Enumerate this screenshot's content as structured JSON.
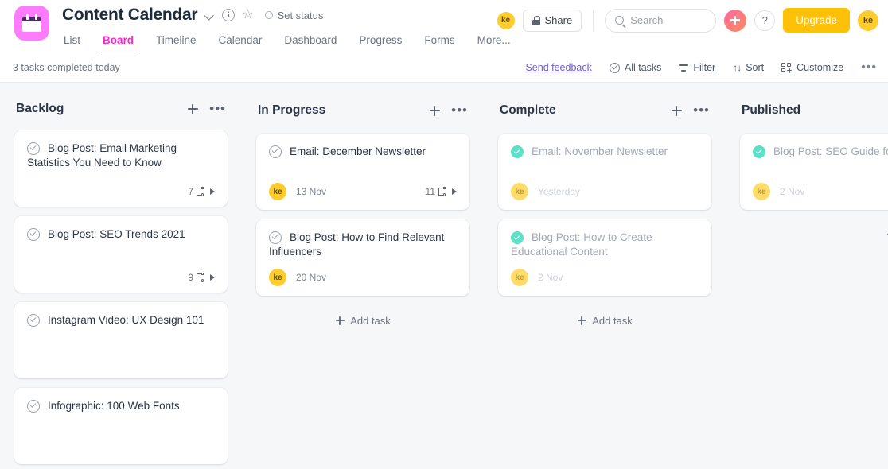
{
  "header": {
    "app_icon": "calendar-icon",
    "title": "Content Calendar",
    "title_chevron": "chevron-down-icon",
    "info_icon": "i",
    "star_icon": "☆",
    "set_status_label": "Set status",
    "tabs": [
      {
        "label": "List",
        "active": false
      },
      {
        "label": "Board",
        "active": true
      },
      {
        "label": "Timeline",
        "active": false
      },
      {
        "label": "Calendar",
        "active": false
      },
      {
        "label": "Dashboard",
        "active": false
      },
      {
        "label": "Progress",
        "active": false
      },
      {
        "label": "Forms",
        "active": false
      },
      {
        "label": "More...",
        "active": false
      }
    ],
    "avatar_initials": "ke",
    "share_label": "Share",
    "share_icon": "lock-icon",
    "search_placeholder": "Search",
    "search_value": "",
    "plus_icon": "plus-icon",
    "help_icon": "?",
    "upgrade_label": "Upgrade",
    "profile_initials": "ke",
    "accent_color": "#ff25ce",
    "avatar_color": "#ffcc2d",
    "upgrade_color": "#ffc107"
  },
  "toolbar": {
    "tasks_today": "3 tasks completed today",
    "feedback_label": "Send feedback",
    "all_tasks_label": "All tasks",
    "filter_label": "Filter",
    "sort_label": "Sort",
    "customize_label": "Customize",
    "overflow_label": "•••"
  },
  "board": {
    "add_task_label": "Add task",
    "columns": [
      {
        "title": "Backlog",
        "show_add_task": false,
        "cards": [
          {
            "title": "Blog Post: Email Marketing Statistics You Need to Know",
            "done": false,
            "assignee": "",
            "date": "",
            "subtasks": "7"
          },
          {
            "title": "Blog Post: SEO Trends 2021",
            "done": false,
            "assignee": "",
            "date": "",
            "subtasks": "9"
          },
          {
            "title": "Instagram Video: UX Design 101",
            "done": false,
            "assignee": "",
            "date": "",
            "subtasks": ""
          },
          {
            "title": "Infographic: 100 Web Fonts",
            "done": false,
            "assignee": "",
            "date": "",
            "subtasks": ""
          }
        ]
      },
      {
        "title": "In Progress",
        "show_add_task": true,
        "cards": [
          {
            "title": "Email: December Newsletter",
            "done": false,
            "assignee": "ke",
            "date": "13 Nov",
            "subtasks": "11"
          },
          {
            "title": "Blog Post: How to Find Relevant Influencers",
            "done": false,
            "assignee": "ke",
            "date": "20 Nov",
            "subtasks": ""
          }
        ]
      },
      {
        "title": "Complete",
        "show_add_task": true,
        "cards": [
          {
            "title": "Email: November Newsletter",
            "done": true,
            "assignee": "ke",
            "date": "Yesterday",
            "subtasks": ""
          },
          {
            "title": "Blog Post: How to Create Educational Content",
            "done": true,
            "assignee": "ke",
            "date": "2 Nov",
            "subtasks": ""
          }
        ]
      },
      {
        "title": "Published",
        "show_add_task": true,
        "cards": [
          {
            "title": "Blog Post: SEO Guide for B",
            "done": true,
            "assignee": "ke",
            "date": "2 Nov",
            "subtasks": ""
          }
        ]
      }
    ]
  }
}
